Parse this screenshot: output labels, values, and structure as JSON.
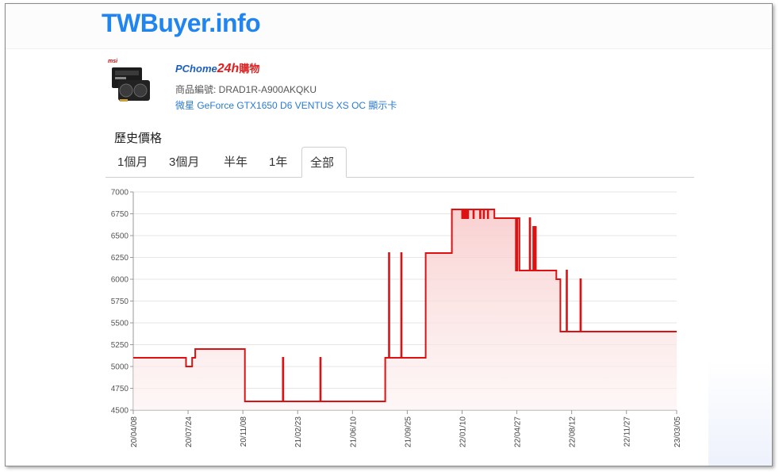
{
  "site": {
    "title": "TWBuyer.info"
  },
  "product": {
    "brand_logo": "msi",
    "store": {
      "pchome": "PChome",
      "num": "24h",
      "buy": "購物"
    },
    "code": "商品編號: DRAD1R-A900AKQKU",
    "name": "微星 GeForce GTX1650 D6 VENTUS XS OC 顯示卡"
  },
  "history": {
    "title": "歷史價格",
    "tabs": [
      {
        "label": "1個月",
        "active": false
      },
      {
        "label": "3個月",
        "active": false
      },
      {
        "label": "半年",
        "active": false
      },
      {
        "label": "1年",
        "active": false
      },
      {
        "label": "全部",
        "active": true
      }
    ]
  },
  "colors": {
    "line": "#dd1111",
    "fill_top": "#f8c8c8",
    "fill_bottom": "#fdf2f2",
    "grid": "#e6e6e6",
    "logo": "#2185f0"
  },
  "chart_data": {
    "type": "area",
    "title": "",
    "xlabel": "",
    "ylabel": "",
    "ylim": [
      4500,
      7000
    ],
    "yticks": [
      4500,
      4750,
      5000,
      5250,
      5500,
      5750,
      6000,
      6250,
      6500,
      6750,
      7000
    ],
    "xticks": [
      "20/04/08",
      "20/07/24",
      "20/11/08",
      "21/02/23",
      "21/06/10",
      "21/09/25",
      "22/01/10",
      "22/04/27",
      "22/08/12",
      "22/11/27",
      "23/03/05"
    ],
    "grid": true,
    "series": [
      {
        "x": [
          "2020-04-08",
          "2020-07-20",
          "2020-07-20",
          "2020-08-01",
          "2020-08-01",
          "2020-08-07",
          "2020-08-07",
          "2020-08-20",
          "2020-08-20",
          "2020-11-12",
          "2020-11-12",
          "2021-01-25",
          "2021-01-25",
          "2021-01-26",
          "2021-01-26",
          "2021-04-08",
          "2021-04-08",
          "2021-04-09",
          "2021-04-09",
          "2021-08-13",
          "2021-08-13",
          "2021-08-20",
          "2021-08-20",
          "2021-08-21",
          "2021-08-21",
          "2021-09-13",
          "2021-09-13",
          "2021-09-14",
          "2021-09-14",
          "2021-10-31",
          "2021-10-31",
          "2021-12-21",
          "2021-12-21",
          "2022-01-10",
          "2022-01-10",
          "2022-01-11",
          "2022-01-11",
          "2022-01-13",
          "2022-01-13",
          "2022-01-14",
          "2022-01-14",
          "2022-01-17",
          "2022-01-17",
          "2022-01-18",
          "2022-01-18",
          "2022-01-21",
          "2022-01-21",
          "2022-01-22",
          "2022-01-22",
          "2022-02-01",
          "2022-02-01",
          "2022-02-02",
          "2022-02-02",
          "2022-02-14",
          "2022-02-14",
          "2022-02-15",
          "2022-02-15",
          "2022-02-21",
          "2022-02-21",
          "2022-02-22",
          "2022-02-22",
          "2022-03-01",
          "2022-03-01",
          "2022-03-02",
          "2022-03-02",
          "2022-03-14",
          "2022-03-14",
          "2022-03-15",
          "2022-03-15",
          "2022-04-25",
          "2022-04-25",
          "2022-04-28",
          "2022-04-28",
          "2022-05-02",
          "2022-05-02",
          "2022-05-22",
          "2022-05-22",
          "2022-05-23",
          "2022-05-23",
          "2022-05-29",
          "2022-05-29",
          "2022-05-30",
          "2022-05-30",
          "2022-06-02",
          "2022-06-02",
          "2022-06-03",
          "2022-06-03",
          "2022-07-13",
          "2022-07-13",
          "2022-07-21",
          "2022-07-21",
          "2022-08-02",
          "2022-08-02",
          "2022-08-03",
          "2022-08-03",
          "2022-08-29",
          "2022-08-29",
          "2022-08-30",
          "2022-08-30",
          "2023-03-05"
        ],
        "y": [
          5100,
          5100,
          5000,
          5000,
          5100,
          5100,
          5200,
          5200,
          5200,
          5200,
          4600,
          4600,
          5100,
          5100,
          4600,
          4600,
          5100,
          5100,
          4600,
          4600,
          5100,
          5100,
          6300,
          6300,
          5100,
          5100,
          6300,
          6300,
          5100,
          5100,
          6300,
          6300,
          6800,
          6800,
          6700,
          6700,
          6800,
          6800,
          6700,
          6700,
          6800,
          6800,
          6700,
          6700,
          6800,
          6800,
          6700,
          6700,
          6800,
          6800,
          6700,
          6700,
          6800,
          6800,
          6700,
          6700,
          6800,
          6800,
          6700,
          6700,
          6800,
          6800,
          6700,
          6700,
          6800,
          6800,
          6700,
          6700,
          6700,
          6700,
          6100,
          6100,
          6700,
          6700,
          6100,
          6100,
          6700,
          6700,
          6100,
          6100,
          6600,
          6600,
          6100,
          6100,
          6600,
          6600,
          6100,
          6100,
          6000,
          6000,
          5400,
          5400,
          6100,
          6100,
          5400,
          5400,
          6000,
          6000,
          5400,
          5400
        ]
      }
    ]
  }
}
